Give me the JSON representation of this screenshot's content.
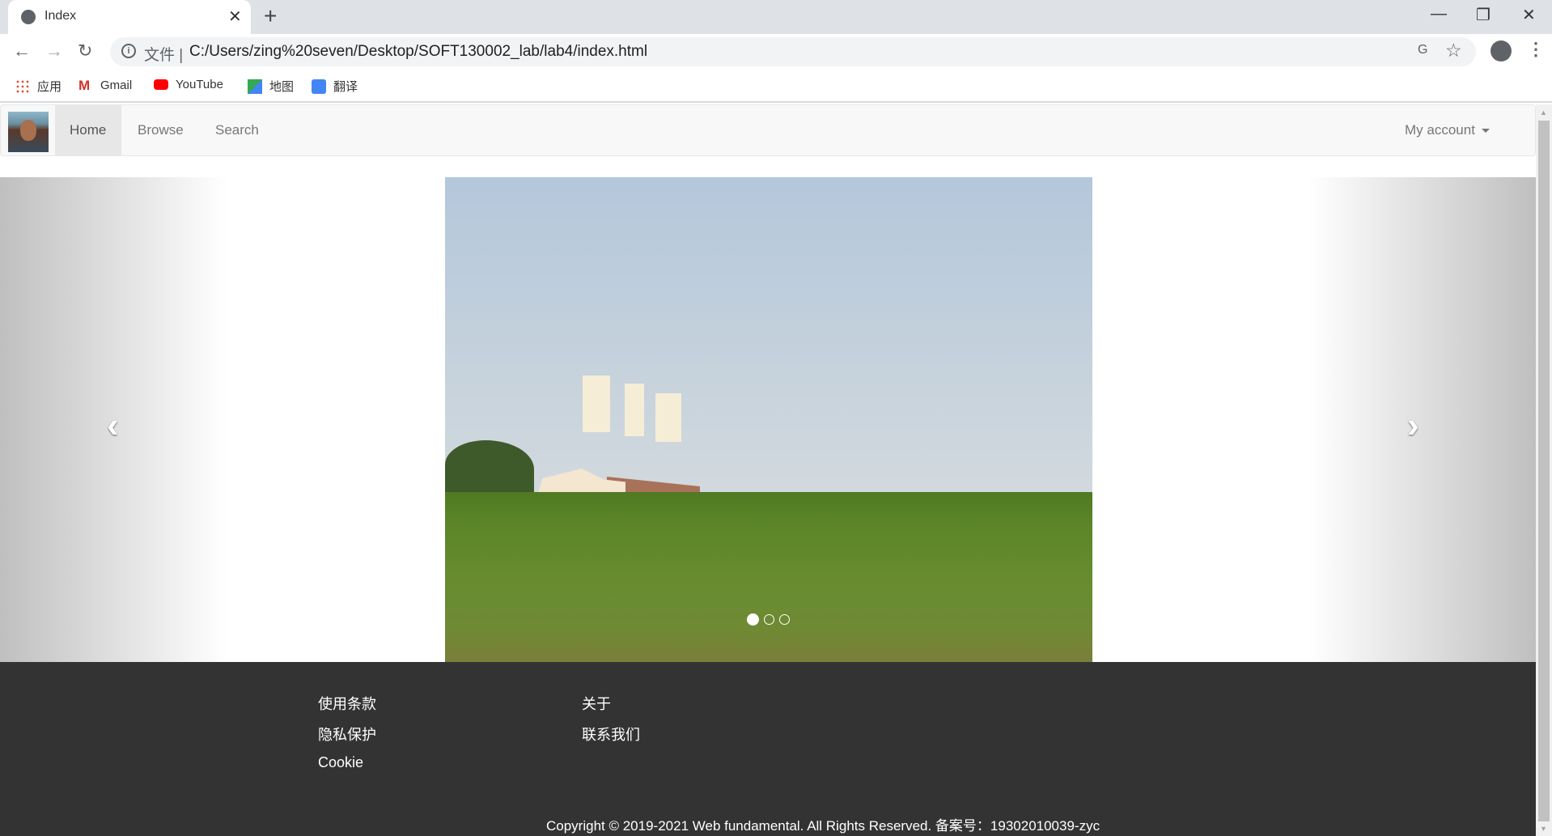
{
  "browser": {
    "tab_title": "Index",
    "tab_close": "✕",
    "new_tab": "+",
    "window_controls": {
      "minimize": "—",
      "restore": "❐",
      "close": "✕"
    },
    "nav": {
      "back": "←",
      "forward": "→",
      "reload": "↻"
    },
    "scheme_label": "文件 |",
    "url": "C:/Users/zing%20seven/Desktop/SOFT130002_lab/lab4/index.html",
    "translate_icon": "G",
    "star_icon": "☆",
    "menu_icon": "⋮",
    "bookmarks": [
      {
        "label": "应用",
        "icon": "apps-icon"
      },
      {
        "label": "Gmail",
        "icon": "gmail-icon"
      },
      {
        "label": "YouTube",
        "icon": "youtube-icon"
      },
      {
        "label": "地图",
        "icon": "maps-icon"
      },
      {
        "label": "翻译",
        "icon": "translate-icon"
      }
    ]
  },
  "navbar": {
    "items": [
      {
        "label": "Home",
        "active": true
      },
      {
        "label": "Browse"
      },
      {
        "label": "Search"
      }
    ],
    "account": "My account"
  },
  "carousel": {
    "prev": "‹",
    "next": "›",
    "slide_count": 3,
    "active_index": 0
  },
  "footer": {
    "col1": [
      "使用条款",
      "隐私保护",
      "Cookie"
    ],
    "col2": [
      "关于",
      "联系我们"
    ],
    "copyright": "Copyright © 2019-2021 Web fundamental. All Rights Reserved. 备案号：19302010039-zyc"
  },
  "colors": {
    "footer_bg": "#333333",
    "navbar_bg": "#f8f8f8",
    "tabbar_bg": "#dee1e6"
  }
}
